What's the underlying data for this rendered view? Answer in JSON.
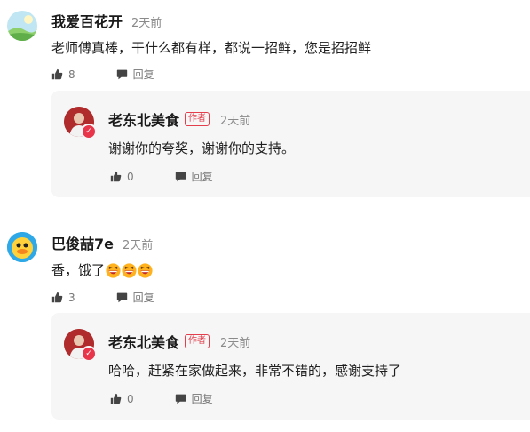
{
  "comments": [
    {
      "author": "我爱百花开",
      "time": "2天前",
      "text": "老师傅真棒，干什么都有样，都说一招鲜，您是招招鲜",
      "likes": "8",
      "reply_label": "回复",
      "reply": {
        "author": "老东北美食",
        "tag": "作者",
        "time": "2天前",
        "text": "谢谢你的夸奖，谢谢你的支持。",
        "likes": "0",
        "reply_label": "回复"
      }
    },
    {
      "author": "巴俊喆7e",
      "time": "2天前",
      "text": "香，饿了",
      "emoji_count": 3,
      "likes": "3",
      "reply_label": "回复",
      "reply": {
        "author": "老东北美食",
        "tag": "作者",
        "time": "2天前",
        "text": "哈哈，赶紧在家做起来，非常不错的，感谢支持了",
        "likes": "0",
        "reply_label": "回复"
      }
    }
  ],
  "colors": {
    "author_tag": "#e33e4c",
    "reply_bg": "#f6f6f7",
    "secondary_text": "#8a8a8a"
  }
}
